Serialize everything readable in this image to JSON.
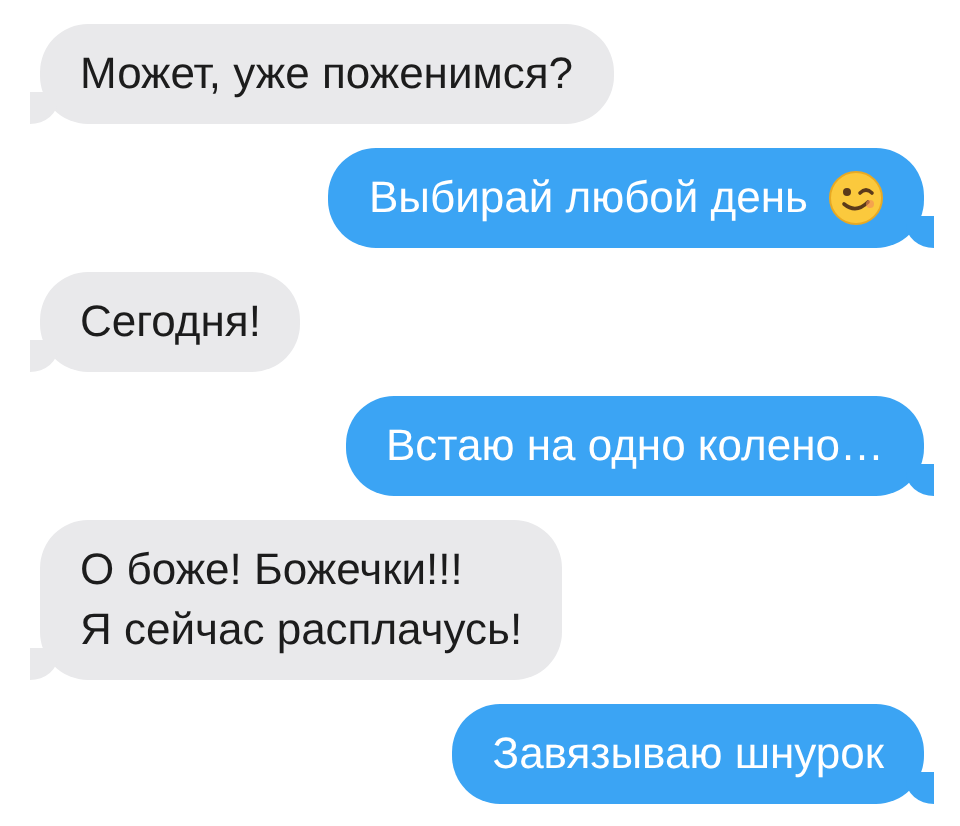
{
  "messages": [
    {
      "outgoing": false,
      "lines": [
        "Может, уже поженимся?"
      ],
      "emoji": false
    },
    {
      "outgoing": true,
      "lines": [
        "Выбирай любой день"
      ],
      "emoji": true
    },
    {
      "outgoing": false,
      "lines": [
        "Сегодня!"
      ],
      "emoji": false
    },
    {
      "outgoing": true,
      "lines": [
        "Встаю на одно колено…"
      ],
      "emoji": false
    },
    {
      "outgoing": false,
      "lines": [
        "О боже! Божечки!!!",
        "Я сейчас расплачусь!"
      ],
      "emoji": false
    },
    {
      "outgoing": true,
      "lines": [
        "Завязываю шнурок"
      ],
      "emoji": false
    }
  ]
}
